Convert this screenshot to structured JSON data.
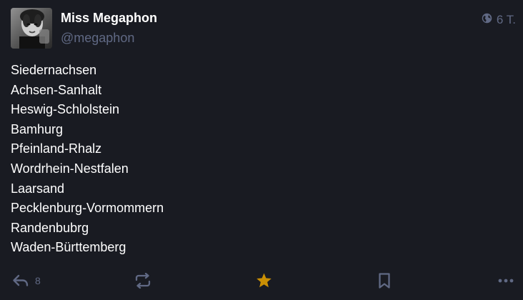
{
  "status": {
    "account": {
      "display_name": "Miss Megaphon",
      "handle": "@megaphon"
    },
    "visibility_icon": "globe-icon",
    "relative_time": "6 T.",
    "lines": [
      "Siedernachsen",
      "Achsen-Sanhalt",
      "Heswig-Schlolstein",
      "Bamhurg",
      "Pfeinland-Rhalz",
      "Wordrhein-Nestfalen",
      "Laarsand",
      "Pecklenburg-Vormommern",
      "Randenbubrg",
      "Waden-Bürttemberg"
    ],
    "actions": {
      "reply_count": "8",
      "favourite_active": true
    }
  },
  "colors": {
    "background": "#191b22",
    "text": "#ffffff",
    "muted": "#606984",
    "favourite": "#ca8f04"
  }
}
